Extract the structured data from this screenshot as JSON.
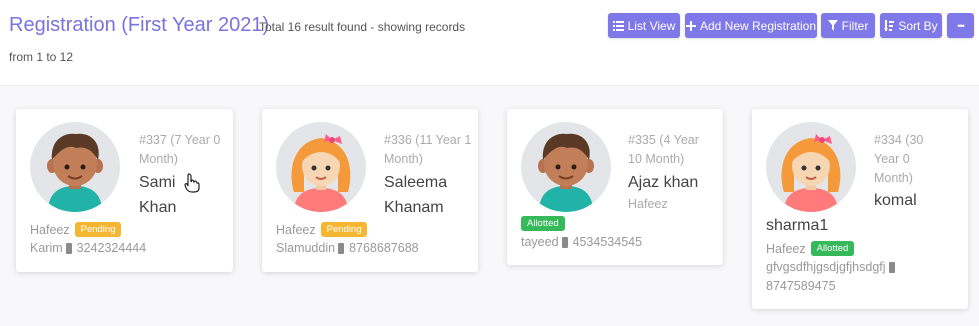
{
  "header": {
    "title": "Registration (First Year 2021)",
    "result_line1": "Total 16 result found - showing records",
    "result_line2": "from 1 to 12"
  },
  "toolbar": {
    "list_view": "List View",
    "add_new": "Add New Registration",
    "filter": "Filter",
    "sort_by": "Sort By",
    "more": "•••"
  },
  "cards": [
    {
      "meta": "#337 (7 Year 0 Month)",
      "name": "Sami Khan",
      "parent": "Hafeez",
      "status": "Pending",
      "contact": "Karim",
      "phone": "3242324444",
      "avatar": "boy-avatar-icon"
    },
    {
      "meta": "#336 (11 Year 1 Month)",
      "name": "Saleema Khanam",
      "parent": "Hafeez",
      "status": "Pending",
      "contact": "Slamuddin",
      "phone": "8768687688",
      "avatar": "girl-avatar-icon"
    },
    {
      "meta": "#335 (4 Year 10 Month)",
      "name": "Ajaz khan",
      "parent": "Hafeez",
      "status": "Allotted",
      "contact": "tayeed",
      "phone": "4534534545",
      "avatar": "boy-avatar-icon"
    },
    {
      "meta": "#334 (30 Year 0 Month)",
      "name_part1": "komal",
      "name_part2": "sharma1",
      "parent": "Hafeez",
      "status": "Allotted",
      "contact": "gfvgsdfhjgsdjgfjhsdgfj",
      "phone": "8747589475",
      "avatar": "girl-avatar-icon"
    }
  ],
  "colors": {
    "accent": "#7f78e8",
    "title": "#7a72e0",
    "pending": "#f5b731",
    "allotted": "#35b95a"
  }
}
